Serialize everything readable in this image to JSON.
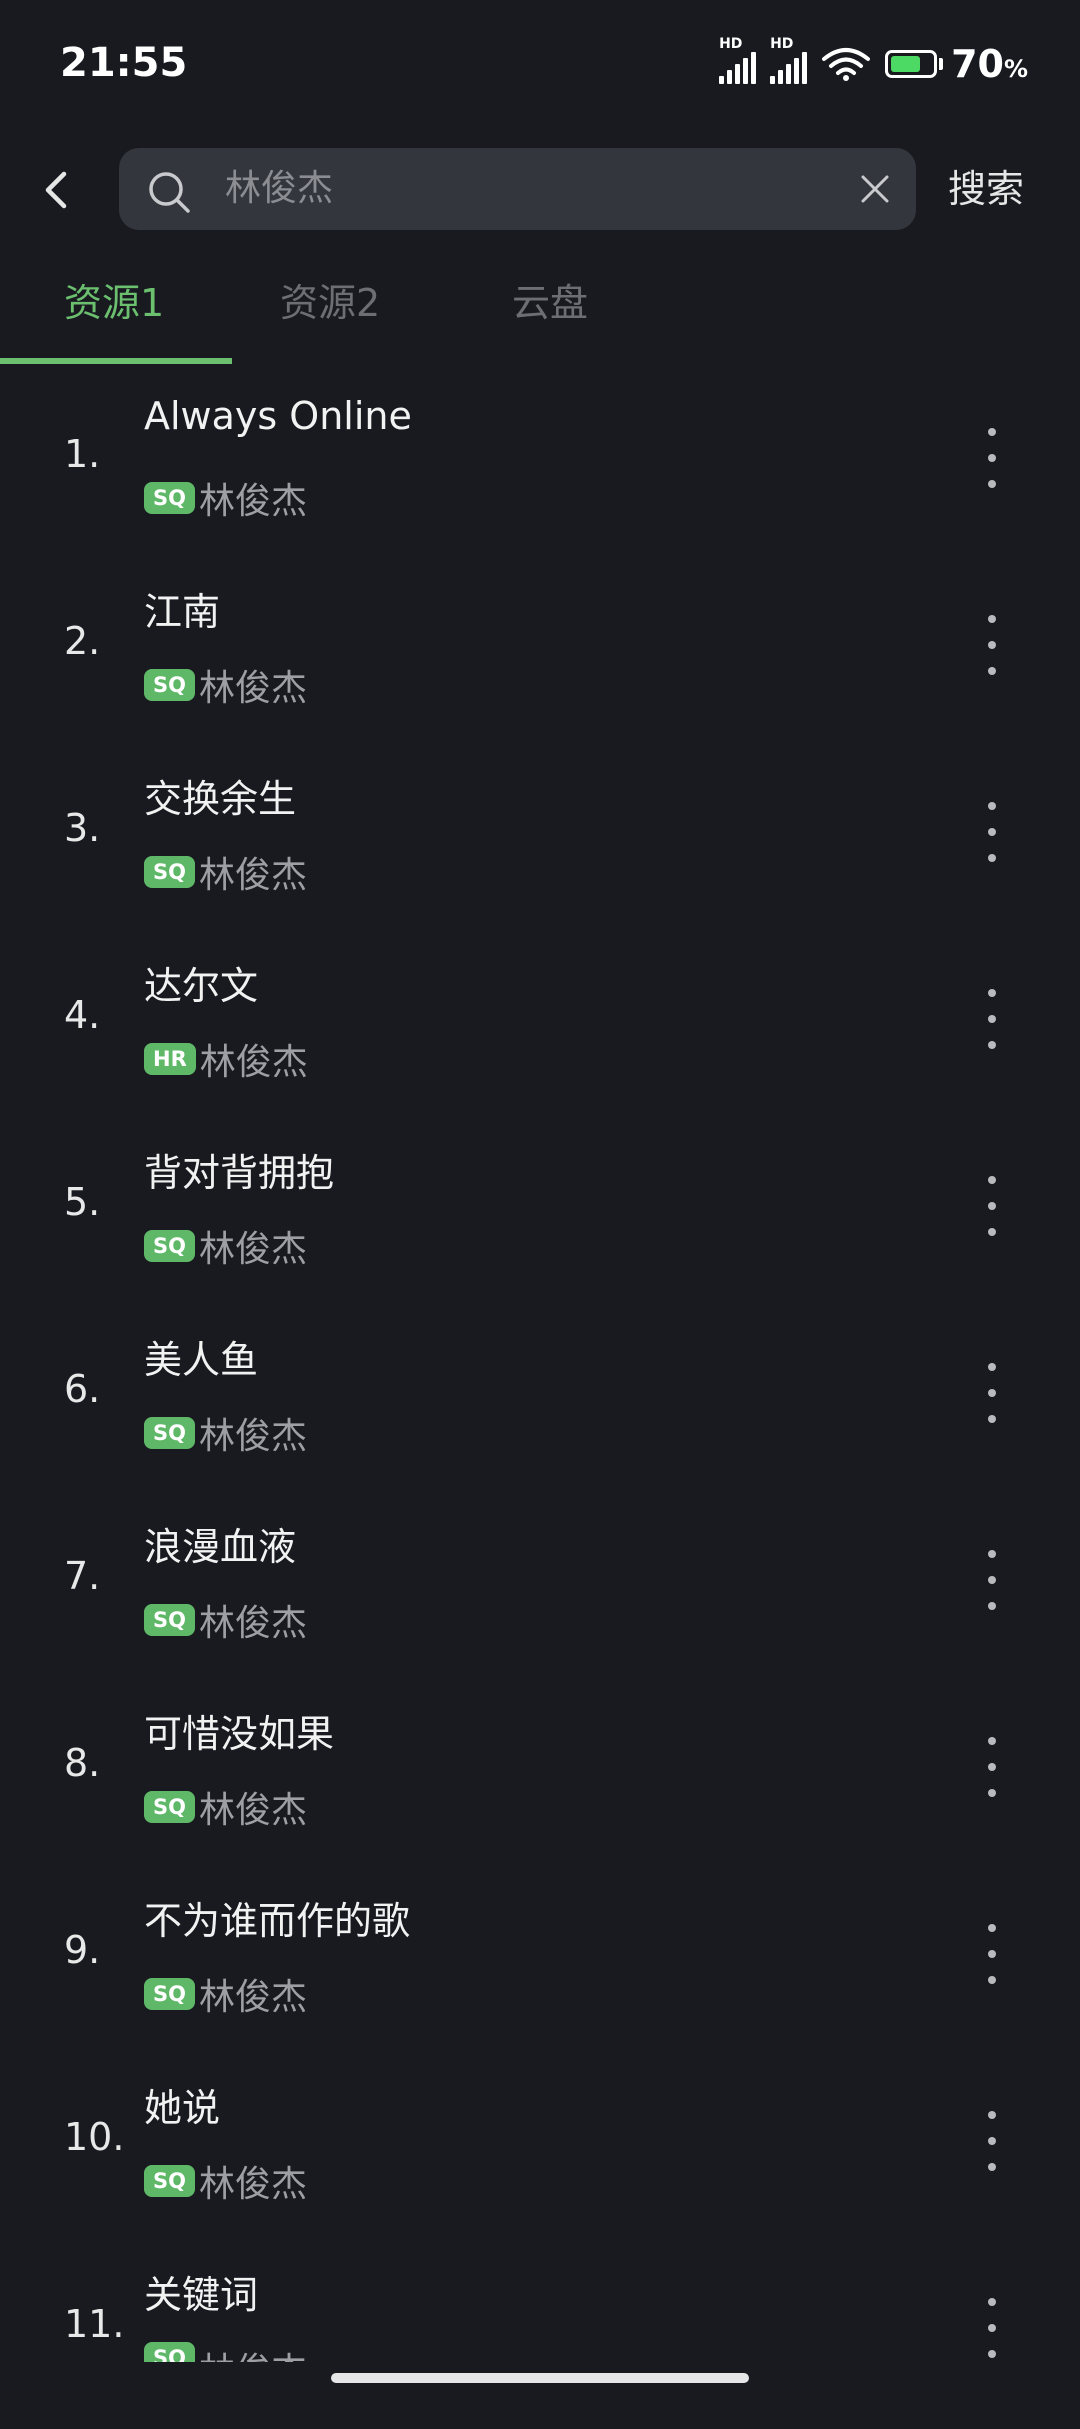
{
  "status": {
    "time": "21:55",
    "hd1": "HD",
    "hd2": "HD",
    "battery_pct": "70",
    "battery_unit": "%"
  },
  "search": {
    "query": "林俊杰",
    "button": "搜索"
  },
  "tabs": [
    {
      "label": "资源1",
      "active": true
    },
    {
      "label": "资源2",
      "active": false
    },
    {
      "label": "云盘",
      "active": false
    }
  ],
  "songs": [
    {
      "num": "1.",
      "title": "Always Online",
      "quality": "SQ",
      "artist": "林俊杰"
    },
    {
      "num": "2.",
      "title": "江南",
      "quality": "SQ",
      "artist": "林俊杰"
    },
    {
      "num": "3.",
      "title": "交换余生",
      "quality": "SQ",
      "artist": "林俊杰"
    },
    {
      "num": "4.",
      "title": "达尔文",
      "quality": "HR",
      "artist": "林俊杰"
    },
    {
      "num": "5.",
      "title": "背对背拥抱",
      "quality": "SQ",
      "artist": "林俊杰"
    },
    {
      "num": "6.",
      "title": "美人鱼",
      "quality": "SQ",
      "artist": "林俊杰"
    },
    {
      "num": "7.",
      "title": "浪漫血液",
      "quality": "SQ",
      "artist": "林俊杰"
    },
    {
      "num": "8.",
      "title": "可惜没如果",
      "quality": "SQ",
      "artist": "林俊杰"
    },
    {
      "num": "9.",
      "title": "不为谁而作的歌",
      "quality": "SQ",
      "artist": "林俊杰"
    },
    {
      "num": "10.",
      "title": "她说",
      "quality": "SQ",
      "artist": "林俊杰"
    },
    {
      "num": "11.",
      "title": "关键词",
      "quality": "SQ",
      "artist": "林俊杰"
    }
  ],
  "colors": {
    "accent": "#6bbf6f",
    "background": "#181a20",
    "badge": "#5fb868"
  }
}
